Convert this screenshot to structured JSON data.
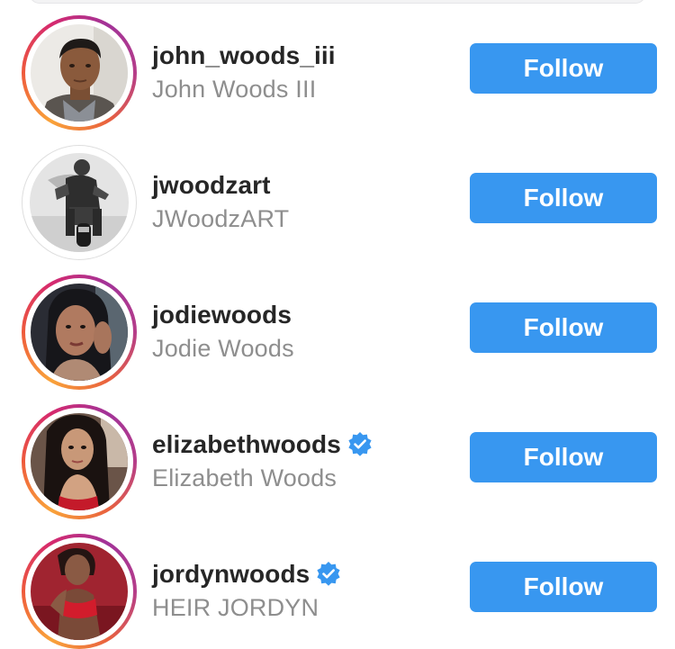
{
  "users": [
    {
      "username": "john_woods_iii",
      "full_name": "John Woods III",
      "verified": false,
      "story_ring": true,
      "avatar_icon": "profile-photo-young-man",
      "follow_label": "Follow"
    },
    {
      "username": "jwoodzart",
      "full_name": "JWoodzART",
      "verified": false,
      "story_ring": false,
      "avatar_icon": "profile-photo-motorcycle-rider",
      "follow_label": "Follow"
    },
    {
      "username": "jodiewoods",
      "full_name": "Jodie Woods",
      "verified": false,
      "story_ring": true,
      "avatar_icon": "profile-photo-woman-selfie",
      "follow_label": "Follow"
    },
    {
      "username": "elizabethwoods",
      "full_name": "Elizabeth Woods",
      "verified": true,
      "story_ring": true,
      "avatar_icon": "profile-photo-woman-long-hair",
      "follow_label": "Follow"
    },
    {
      "username": "jordynwoods",
      "full_name": "HEIR JORDYN",
      "verified": true,
      "story_ring": true,
      "avatar_icon": "profile-photo-woman-red",
      "follow_label": "Follow"
    }
  ],
  "colors": {
    "follow_button": "#3897f0",
    "username_text": "#262626",
    "fullname_text": "#8e8e8e",
    "verified_badge": "#3897f0"
  }
}
